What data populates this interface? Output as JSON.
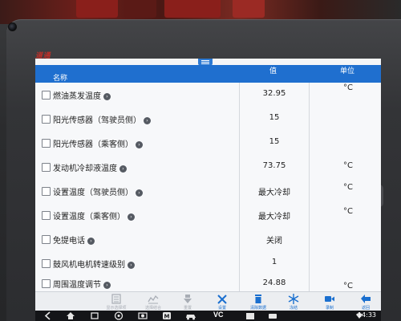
{
  "device": {
    "brand": "道通",
    "side_button": "M"
  },
  "table": {
    "headers": {
      "name": "名称",
      "value": "值",
      "unit": "单位"
    },
    "rows": [
      {
        "name": "燃油蒸发温度",
        "value": "32.95",
        "unit": "°C"
      },
      {
        "name": "阳光传感器（驾驶员侧）",
        "value": "15",
        "unit": ""
      },
      {
        "name": "阳光传感器（乘客侧）",
        "value": "15",
        "unit": ""
      },
      {
        "name": "发动机冷却液温度",
        "value": "73.75",
        "unit": "°C"
      },
      {
        "name": "设置温度（驾驶员侧）",
        "value": "最大冷却",
        "unit": "°C"
      },
      {
        "name": "设置温度（乘客侧）",
        "value": "最大冷却",
        "unit": "°C"
      },
      {
        "name": "免提电话",
        "value": "关闭",
        "unit": ""
      },
      {
        "name": "鼓风机电机转速级别",
        "value": "1",
        "unit": ""
      },
      {
        "name": "周围温度调节",
        "value": "24.88",
        "unit": "°C"
      }
    ]
  },
  "toolbar": {
    "items": [
      {
        "label": "显示选择项",
        "icon": "list-select-icon",
        "enabled": false
      },
      {
        "label": "选择结合",
        "icon": "combine-icon",
        "enabled": false
      },
      {
        "label": "重置",
        "icon": "reset-icon",
        "enabled": false
      },
      {
        "label": "设置",
        "icon": "tools-icon",
        "enabled": true
      },
      {
        "label": "清除数据",
        "icon": "trash-icon",
        "enabled": true
      },
      {
        "label": "冻结",
        "icon": "snowflake-icon",
        "enabled": true
      },
      {
        "label": "录制",
        "icon": "video-camera-icon",
        "enabled": true
      },
      {
        "label": "返回",
        "icon": "back-arrow-icon",
        "enabled": true
      }
    ]
  },
  "navbar": {
    "clock": "14:33",
    "vci_label": "VC"
  },
  "colors": {
    "header_blue": "#1f6fcf",
    "toolbar_icon_blue": "#1a6fcf",
    "brand_red": "#c0302a"
  }
}
